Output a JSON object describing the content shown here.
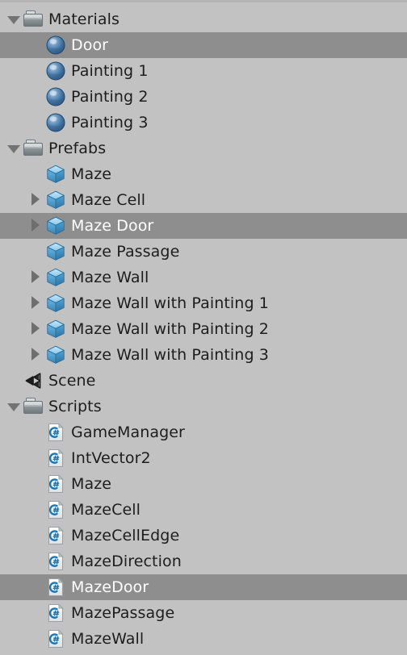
{
  "panel": {
    "name": "project-asset-tree",
    "background_color": "#c2c2c2",
    "selection_color": "#8e8e8e",
    "text_color": "#1d1d1d",
    "selected_text_color": "#ffffff"
  },
  "tree": {
    "items": [
      {
        "label": "Materials",
        "icon": "folder-icon",
        "indent": 0,
        "twisty": "down",
        "selected": false
      },
      {
        "label": "Door",
        "icon": "material-icon",
        "indent": 1,
        "twisty": "none",
        "selected": true
      },
      {
        "label": "Painting 1",
        "icon": "material-icon",
        "indent": 1,
        "twisty": "none",
        "selected": false
      },
      {
        "label": "Painting 2",
        "icon": "material-icon",
        "indent": 1,
        "twisty": "none",
        "selected": false
      },
      {
        "label": "Painting 3",
        "icon": "material-icon",
        "indent": 1,
        "twisty": "none",
        "selected": false
      },
      {
        "label": "Prefabs",
        "icon": "folder-icon",
        "indent": 0,
        "twisty": "down",
        "selected": false
      },
      {
        "label": "Maze",
        "icon": "prefab-icon",
        "indent": 1,
        "twisty": "none",
        "selected": false
      },
      {
        "label": "Maze Cell",
        "icon": "prefab-icon",
        "indent": 1,
        "twisty": "right",
        "selected": false
      },
      {
        "label": "Maze Door",
        "icon": "prefab-icon",
        "indent": 1,
        "twisty": "right",
        "selected": true
      },
      {
        "label": "Maze Passage",
        "icon": "prefab-icon",
        "indent": 1,
        "twisty": "none",
        "selected": false
      },
      {
        "label": "Maze Wall",
        "icon": "prefab-icon",
        "indent": 1,
        "twisty": "right",
        "selected": false
      },
      {
        "label": "Maze Wall with Painting 1",
        "icon": "prefab-icon",
        "indent": 1,
        "twisty": "right",
        "selected": false
      },
      {
        "label": "Maze Wall with Painting 2",
        "icon": "prefab-icon",
        "indent": 1,
        "twisty": "right",
        "selected": false
      },
      {
        "label": "Maze Wall with Painting 3",
        "icon": "prefab-icon",
        "indent": 1,
        "twisty": "right",
        "selected": false
      },
      {
        "label": "Scene",
        "icon": "unity-scene-icon",
        "indent": 0,
        "twisty": "none",
        "selected": false
      },
      {
        "label": "Scripts",
        "icon": "folder-icon",
        "indent": 0,
        "twisty": "down",
        "selected": false
      },
      {
        "label": "GameManager",
        "icon": "csharp-script-icon",
        "indent": 1,
        "twisty": "none",
        "selected": false
      },
      {
        "label": "IntVector2",
        "icon": "csharp-script-icon",
        "indent": 1,
        "twisty": "none",
        "selected": false
      },
      {
        "label": "Maze",
        "icon": "csharp-script-icon",
        "indent": 1,
        "twisty": "none",
        "selected": false
      },
      {
        "label": "MazeCell",
        "icon": "csharp-script-icon",
        "indent": 1,
        "twisty": "none",
        "selected": false
      },
      {
        "label": "MazeCellEdge",
        "icon": "csharp-script-icon",
        "indent": 1,
        "twisty": "none",
        "selected": false
      },
      {
        "label": "MazeDirection",
        "icon": "csharp-script-icon",
        "indent": 1,
        "twisty": "none",
        "selected": false
      },
      {
        "label": "MazeDoor",
        "icon": "csharp-script-icon",
        "indent": 1,
        "twisty": "none",
        "selected": true
      },
      {
        "label": "MazePassage",
        "icon": "csharp-script-icon",
        "indent": 1,
        "twisty": "none",
        "selected": false
      },
      {
        "label": "MazeWall",
        "icon": "csharp-script-icon",
        "indent": 1,
        "twisty": "none",
        "selected": false
      }
    ]
  },
  "icon_colors": {
    "folder": "#8f9799",
    "material_sphere": "#4a79a8",
    "prefab_cube": "#4aa3d8",
    "csharp_blue": "#1878b4",
    "unity_logo": "#1b1b1b"
  }
}
